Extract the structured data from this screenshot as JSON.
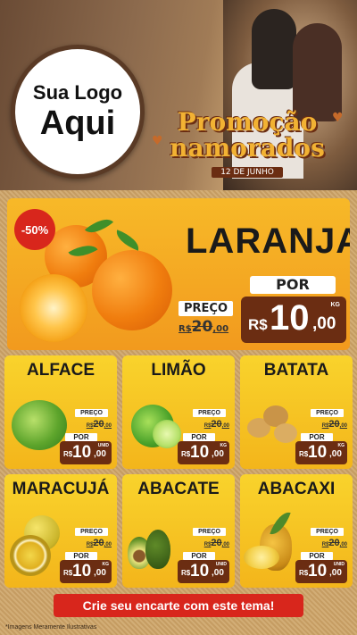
{
  "header": {
    "logo_line1": "Sua Logo",
    "logo_line2": "Aqui",
    "promo_line1": "Promoção",
    "promo_line2": "namorados",
    "promo_date": "12 DE JUNHO"
  },
  "featured": {
    "discount": "-50%",
    "name": "LARANJA",
    "old_label": "PREÇO",
    "old_price_currency": "R$",
    "old_price_int": "20",
    "old_price_dec": ",00",
    "new_label": "POR",
    "new_currency": "R$",
    "new_int": "10",
    "new_dec": ",00",
    "unit": "KG"
  },
  "products": [
    {
      "name": "ALFACE",
      "old_label": "PREÇO",
      "old_cur": "R$",
      "old_int": "20",
      "old_dec": ",00",
      "new_label": "POR",
      "new_cur": "R$",
      "new_int": "10",
      "new_dec": ",00",
      "unit": "UNID"
    },
    {
      "name": "LIMÃO",
      "old_label": "PREÇO",
      "old_cur": "R$",
      "old_int": "20",
      "old_dec": ",00",
      "new_label": "POR",
      "new_cur": "R$",
      "new_int": "10",
      "new_dec": ",00",
      "unit": "KG"
    },
    {
      "name": "BATATA",
      "old_label": "PREÇO",
      "old_cur": "R$",
      "old_int": "20",
      "old_dec": ",00",
      "new_label": "POR",
      "new_cur": "R$",
      "new_int": "10",
      "new_dec": ",00",
      "unit": "KG"
    },
    {
      "name": "MARACUJÁ",
      "old_label": "PREÇO",
      "old_cur": "R$",
      "old_int": "20",
      "old_dec": ",00",
      "new_label": "POR",
      "new_cur": "R$",
      "new_int": "10",
      "new_dec": ",00",
      "unit": "KG"
    },
    {
      "name": "ABACATE",
      "old_label": "PREÇO",
      "old_cur": "R$",
      "old_int": "20",
      "old_dec": ",00",
      "new_label": "POR",
      "new_cur": "R$",
      "new_int": "10",
      "new_dec": ",00",
      "unit": "UNID"
    },
    {
      "name": "ABACAXI",
      "old_label": "PREÇO",
      "old_cur": "R$",
      "old_int": "20",
      "old_dec": ",00",
      "new_label": "POR",
      "new_cur": "R$",
      "new_int": "10",
      "new_dec": ",00",
      "unit": "UNID"
    }
  ],
  "cta": "Crie seu encarte com este tema!",
  "disclaimer": "*Imagens Meramente Ilustrativas",
  "colors": {
    "accent_red": "#d8261c",
    "price_brown": "#6b2d12",
    "card_yellow": "#f9d32c",
    "hero_orange": "#f29a1e"
  }
}
